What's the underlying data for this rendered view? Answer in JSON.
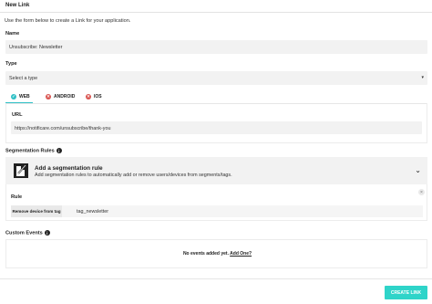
{
  "header": {
    "title": "New Link"
  },
  "intro": "Use the form below to create a Link for your application.",
  "name": {
    "label": "Name",
    "value": "Unsubscribe: Newsletter"
  },
  "type": {
    "label": "Type",
    "value": "Select a type"
  },
  "tabs": [
    {
      "label": "WEB",
      "status": "active",
      "icon": "check-icon"
    },
    {
      "label": "ANDROID",
      "status": "error",
      "icon": "x-icon"
    },
    {
      "label": "IOS",
      "status": "error",
      "icon": "x-icon"
    }
  ],
  "url": {
    "label": "URL",
    "value": "https://notificare.com/unsubscribe/thank-you"
  },
  "segmentation": {
    "label": "Segmentation Rules",
    "add_title": "Add a segmentation rule",
    "add_sub": "Add segmentation rules to automatically add or remove users/devices from segments/tags.",
    "rule_label": "Rule",
    "rule_action": "Remove device from tag",
    "rule_value": "tag_newsletter"
  },
  "events": {
    "label": "Custom Events",
    "empty_text": "No events added yet.",
    "add_link": "Add One?"
  },
  "footer": {
    "create_label": "CREATE LINK"
  },
  "colors": {
    "accent": "#2fd4c9",
    "tab_active": "#2fc0c6",
    "error": "#d9534f"
  }
}
